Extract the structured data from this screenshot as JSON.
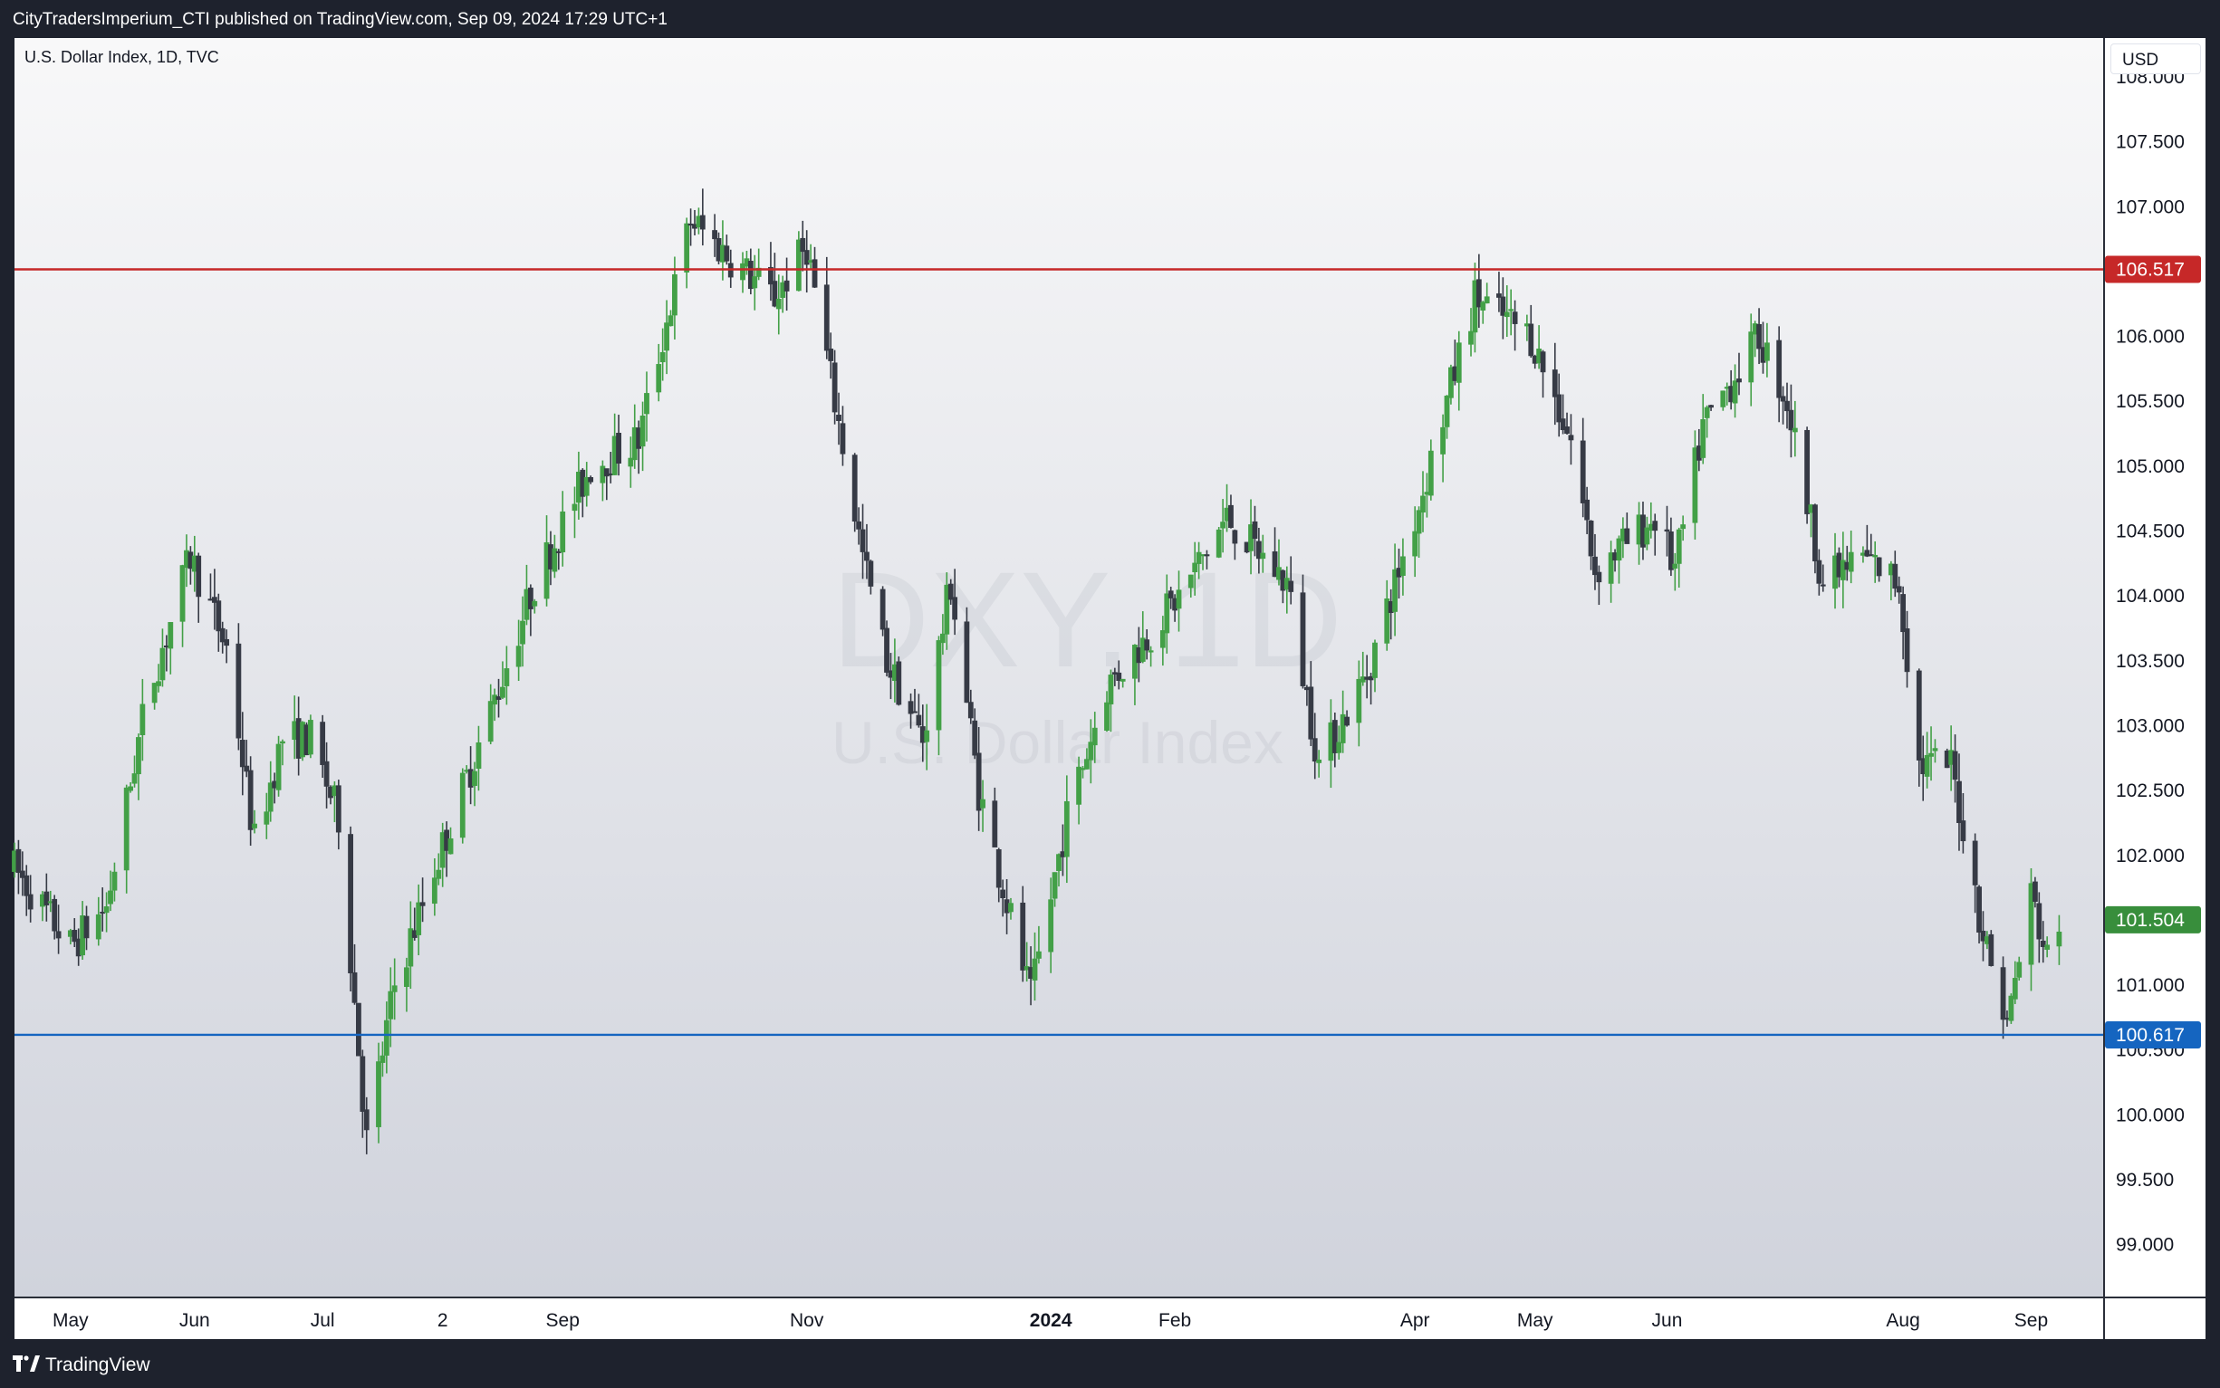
{
  "header": {
    "published_text": "CityTradersImperium_CTI published on TradingView.com, Sep 09, 2024 17:29 UTC+1"
  },
  "chart": {
    "symbol_line": "U.S. Dollar Index, 1D, TVC",
    "currency": "USD",
    "watermark_symbol": "DXY, 1D",
    "watermark_name": "U.S. Dollar Index"
  },
  "footer": {
    "brand": "TradingView"
  },
  "colors": {
    "up": "#43a047",
    "down": "#363a45",
    "resistance": "#c62828",
    "support": "#1565c0",
    "last_price": "#388e3c"
  },
  "chart_data": {
    "type": "candlestick",
    "title": "U.S. Dollar Index, 1D, TVC",
    "ylabel": "USD",
    "ylim": [
      98.6,
      108.3
    ],
    "y_ticks": [
      "99.000",
      "99.500",
      "100.000",
      "100.500",
      "101.000",
      "101.500",
      "102.000",
      "102.500",
      "103.000",
      "103.500",
      "104.000",
      "104.500",
      "105.000",
      "105.500",
      "106.000",
      "106.500",
      "107.000",
      "107.500",
      "108.000"
    ],
    "x_ticks": [
      {
        "label": "May",
        "date": "2023-05-01",
        "bold": false
      },
      {
        "label": "Jun",
        "date": "2023-06-01",
        "bold": false
      },
      {
        "label": "Jul",
        "date": "2023-07-03",
        "bold": false
      },
      {
        "label": "2",
        "date": "2023-08-02",
        "bold": false
      },
      {
        "label": "Sep",
        "date": "2023-09-01",
        "bold": false
      },
      {
        "label": "Nov",
        "date": "2023-11-01",
        "bold": false
      },
      {
        "label": "2024",
        "date": "2024-01-01",
        "bold": true
      },
      {
        "label": "Feb",
        "date": "2024-02-01",
        "bold": false
      },
      {
        "label": "Apr",
        "date": "2024-04-01",
        "bold": false
      },
      {
        "label": "May",
        "date": "2024-05-01",
        "bold": false
      },
      {
        "label": "Jun",
        "date": "2024-06-03",
        "bold": false
      },
      {
        "label": "Aug",
        "date": "2024-08-01",
        "bold": false
      },
      {
        "label": "Sep",
        "date": "2024-09-02",
        "bold": false
      }
    ],
    "x_range": [
      "2023-04-17",
      "2024-09-20"
    ],
    "levels": [
      {
        "name": "resistance",
        "value": 106.517,
        "label": "106.517",
        "color": "#c62828"
      },
      {
        "name": "support",
        "value": 100.617,
        "label": "100.617",
        "color": "#1565c0"
      }
    ],
    "last_price": {
      "value": 101.504,
      "label": "101.504",
      "color": "#388e3c"
    },
    "price_path": [
      [
        "2023-04-17",
        101.9
      ],
      [
        "2023-05-01",
        101.3
      ],
      [
        "2023-05-10",
        101.6
      ],
      [
        "2023-05-20",
        103.2
      ],
      [
        "2023-05-31",
        104.3
      ],
      [
        "2023-06-09",
        103.6
      ],
      [
        "2023-06-16",
        102.1
      ],
      [
        "2023-06-23",
        102.9
      ],
      [
        "2023-06-30",
        102.9
      ],
      [
        "2023-07-07",
        102.3
      ],
      [
        "2023-07-14",
        99.8
      ],
      [
        "2023-07-21",
        101.0
      ],
      [
        "2023-07-31",
        101.9
      ],
      [
        "2023-08-15",
        103.2
      ],
      [
        "2023-08-25",
        104.1
      ],
      [
        "2023-09-08",
        105.0
      ],
      [
        "2023-09-20",
        105.2
      ],
      [
        "2023-10-03",
        106.9
      ],
      [
        "2023-10-13",
        106.6
      ],
      [
        "2023-10-24",
        106.3
      ],
      [
        "2023-11-01",
        106.7
      ],
      [
        "2023-11-08",
        105.5
      ],
      [
        "2023-11-15",
        104.3
      ],
      [
        "2023-11-21",
        103.5
      ],
      [
        "2023-11-30",
        102.9
      ],
      [
        "2023-12-07",
        104.1
      ],
      [
        "2023-12-14",
        102.5
      ],
      [
        "2023-12-27",
        100.9
      ],
      [
        "2024-01-05",
        102.3
      ],
      [
        "2024-01-15",
        103.3
      ],
      [
        "2024-02-02",
        104.0
      ],
      [
        "2024-02-14",
        104.6
      ],
      [
        "2024-02-29",
        104.1
      ],
      [
        "2024-03-08",
        102.7
      ],
      [
        "2024-03-20",
        103.4
      ],
      [
        "2024-04-02",
        104.7
      ],
      [
        "2024-04-16",
        106.3
      ],
      [
        "2024-04-30",
        106.0
      ],
      [
        "2024-05-10",
        105.2
      ],
      [
        "2024-05-16",
        104.2
      ],
      [
        "2024-05-31",
        104.6
      ],
      [
        "2024-06-05",
        104.2
      ],
      [
        "2024-06-12",
        105.3
      ],
      [
        "2024-06-26",
        106.0
      ],
      [
        "2024-07-03",
        105.5
      ],
      [
        "2024-07-12",
        104.1
      ],
      [
        "2024-07-22",
        104.3
      ],
      [
        "2024-07-31",
        104.1
      ],
      [
        "2024-08-05",
        102.7
      ],
      [
        "2024-08-13",
        102.7
      ],
      [
        "2024-08-21",
        101.4
      ],
      [
        "2024-08-27",
        100.7
      ],
      [
        "2024-09-02",
        101.7
      ],
      [
        "2024-09-06",
        101.2
      ],
      [
        "2024-09-09",
        101.504
      ]
    ]
  }
}
